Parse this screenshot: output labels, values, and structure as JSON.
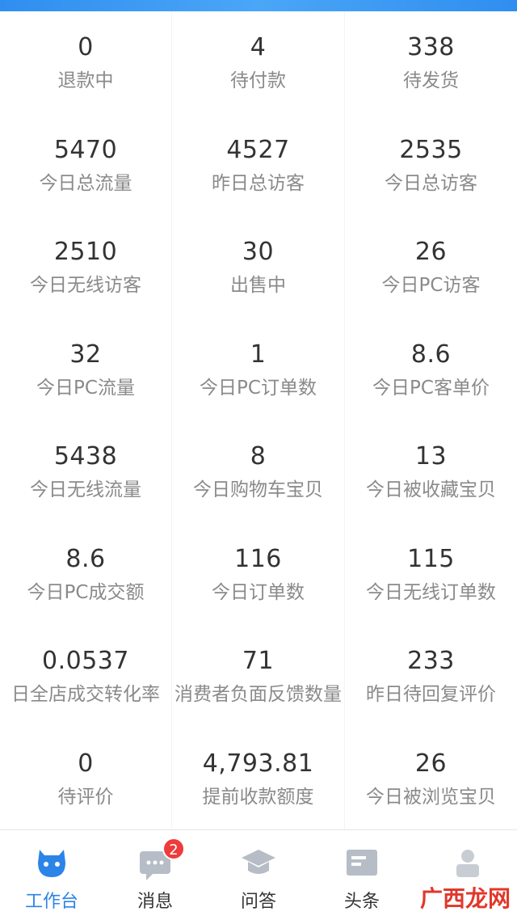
{
  "stats": [
    {
      "value": "0",
      "label": "退款中"
    },
    {
      "value": "4",
      "label": "待付款"
    },
    {
      "value": "338",
      "label": "待发货"
    },
    {
      "value": "5470",
      "label": "今日总流量"
    },
    {
      "value": "4527",
      "label": "昨日总访客"
    },
    {
      "value": "2535",
      "label": "今日总访客"
    },
    {
      "value": "2510",
      "label": "今日无线访客"
    },
    {
      "value": "30",
      "label": "出售中"
    },
    {
      "value": "26",
      "label": "今日PC访客"
    },
    {
      "value": "32",
      "label": "今日PC流量"
    },
    {
      "value": "1",
      "label": "今日PC订单数"
    },
    {
      "value": "8.6",
      "label": "今日PC客单价"
    },
    {
      "value": "5438",
      "label": "今日无线流量"
    },
    {
      "value": "8",
      "label": "今日购物车宝贝"
    },
    {
      "value": "13",
      "label": "今日被收藏宝贝"
    },
    {
      "value": "8.6",
      "label": "今日PC成交额"
    },
    {
      "value": "116",
      "label": "今日订单数"
    },
    {
      "value": "115",
      "label": "今日无线订单数"
    },
    {
      "value": "0.0537",
      "label": "日全店成交转化率"
    },
    {
      "value": "71",
      "label": "消费者负面反馈数量"
    },
    {
      "value": "233",
      "label": "昨日待回复评价"
    },
    {
      "value": "0",
      "label": "待评价"
    },
    {
      "value": "4,793.81",
      "label": "提前收款额度"
    },
    {
      "value": "26",
      "label": "今日被浏览宝贝"
    }
  ],
  "tabs": [
    {
      "label": "工作台",
      "icon": "workbench-icon",
      "active": true
    },
    {
      "label": "消息",
      "icon": "message-icon",
      "badge": "2"
    },
    {
      "label": "问答",
      "icon": "graduation-cap-icon"
    },
    {
      "label": "头条",
      "icon": "news-icon"
    },
    {
      "label": "",
      "icon": "user-icon"
    }
  ],
  "watermark": "广西龙网",
  "colors": {
    "accent": "#2b84e8",
    "badge": "#ee3b3b",
    "icon_gray": "#b7bdc6"
  }
}
